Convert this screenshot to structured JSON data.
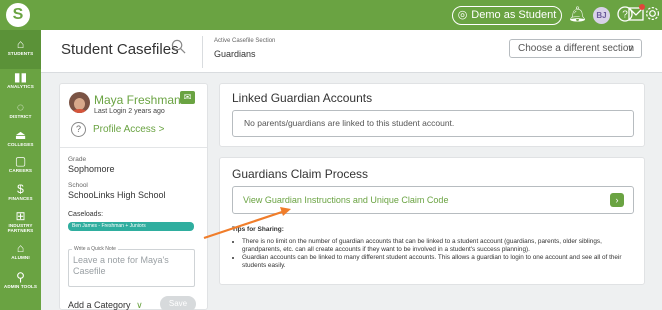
{
  "topbar": {
    "logo_letter": "S",
    "demo_label": "Demo as Student",
    "avatar_initials": "BJ",
    "accent_color": "#6aa342"
  },
  "sidebar": {
    "items": [
      {
        "label": "STUDENTS",
        "icon": "home-icon"
      },
      {
        "label": "ANALYTICS",
        "icon": "chart-icon"
      },
      {
        "label": "DISTRICT",
        "icon": "district-icon"
      },
      {
        "label": "COLLEGES",
        "icon": "college-icon"
      },
      {
        "label": "CAREERS",
        "icon": "briefcase-icon"
      },
      {
        "label": "FINANCES",
        "icon": "dollar-icon"
      },
      {
        "label": "INDUSTRY PARTNERS",
        "icon": "gift-icon"
      },
      {
        "label": "ALUMNI",
        "icon": "graduation-cap-icon"
      },
      {
        "label": "ADMIN TOOLS",
        "icon": "admin-tools-icon"
      }
    ]
  },
  "header": {
    "title": "Student Casefiles",
    "active_section_label": "Active Casefile Section",
    "active_section_value": "Guardians",
    "section_select": "Choose a different section"
  },
  "profile": {
    "name": "Maya Freshman",
    "last_login": "Last Login 2 years ago",
    "profile_access": "Profile Access >",
    "grade_label": "Grade",
    "grade_value": "Sophomore",
    "school_label": "School",
    "school_value": "SchooLinks High School",
    "caseloads_label": "Caseloads:",
    "caseload_pill": "Ben James - Freshman + Juniors",
    "note_legend": "Write a Quick Note",
    "note_placeholder": "Leave a note for Maya's Casefile",
    "add_category": "Add a Category",
    "save_label": "Save"
  },
  "linked": {
    "title": "Linked Guardian Accounts",
    "message": "No parents/guardians are linked to this student account."
  },
  "claim": {
    "title": "Guardians Claim Process",
    "link_text": "View Guardian Instructions and Unique Claim Code",
    "tips_title": "Tips for Sharing:",
    "tips": [
      "There is no limit on the number of guardian accounts that can be linked to a student account (guardians, parents, older siblings, grandparents, etc. can all create accounts if they want to be involved in a student's success planning).",
      "Guardian accounts can be linked to many different student accounts. This allows a guardian to login to one account and see all of their students easily."
    ]
  },
  "annotation_color": "#f07d2a"
}
